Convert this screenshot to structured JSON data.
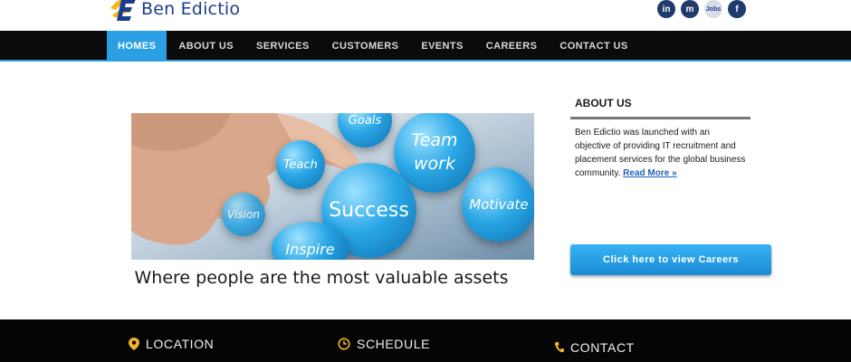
{
  "brand": {
    "name": "Ben Edictio"
  },
  "social": [
    {
      "name": "linkedin",
      "glyph": "in"
    },
    {
      "name": "meetup",
      "glyph": "m"
    },
    {
      "name": "jobs",
      "glyph": "Jobs"
    },
    {
      "name": "facebook",
      "glyph": "f"
    }
  ],
  "nav": {
    "items": [
      "HOMES",
      "ABOUT US",
      "SERVICES",
      "CUSTOMERS",
      "EVENTS",
      "CAREERS",
      "CONTACT US"
    ],
    "active": "HOMES"
  },
  "hero": {
    "bubbles": [
      "Goals",
      "Team work",
      "Teach",
      "Success",
      "Motivate",
      "Vision",
      "Inspire"
    ],
    "tagline": "Where people are the most valuable assets"
  },
  "about": {
    "title": "ABOUT US",
    "text": "Ben Edictio was launched with an objective of providing IT recruitment and placement services for the global business community.",
    "link": "Read More »"
  },
  "careers_button": "Click here to view Careers",
  "footer": {
    "location": "LOCATION",
    "schedule": "SCHEDULE",
    "contact": "CONTACT"
  },
  "colors": {
    "accent": "#2b9fe3",
    "nav_bg": "#0b0b0b",
    "footer_bg": "#050505",
    "footer_icon": "#f1b52a"
  }
}
